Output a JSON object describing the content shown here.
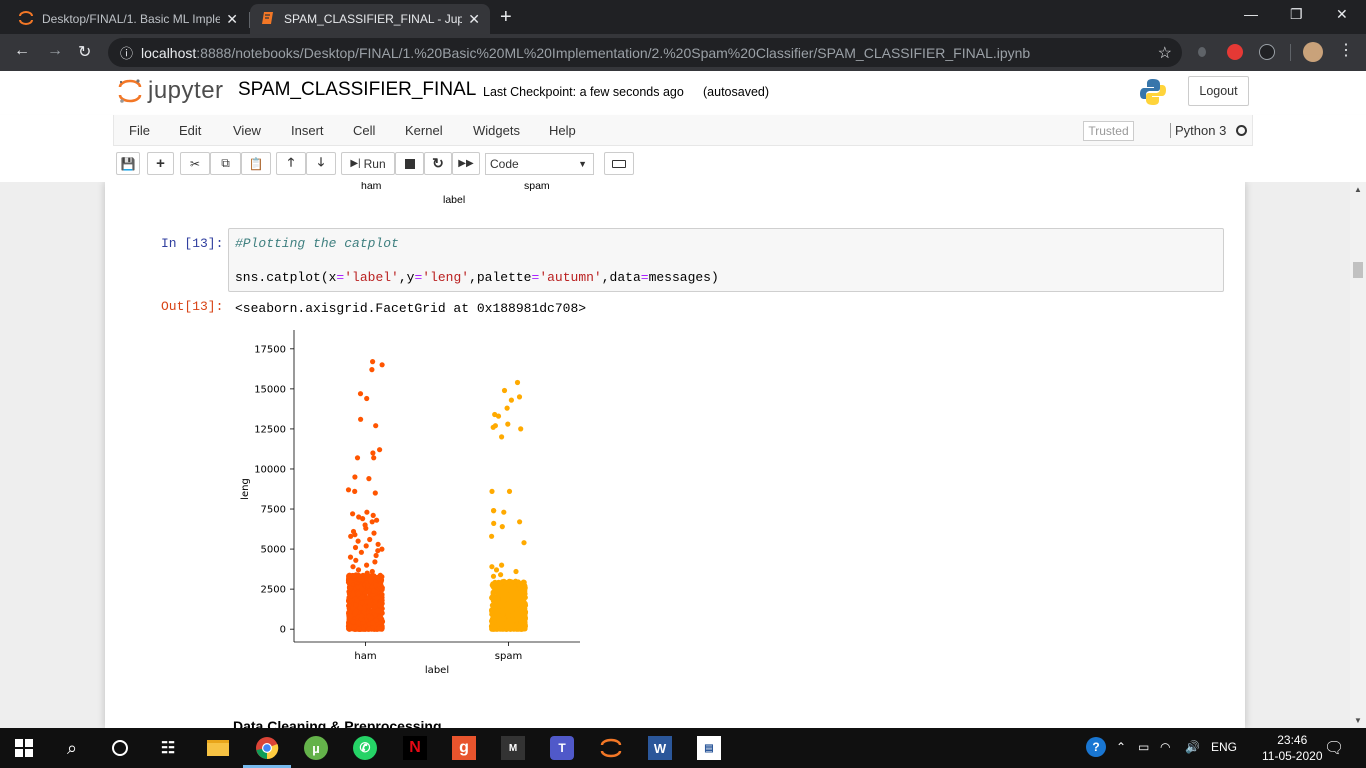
{
  "browser": {
    "tabs": [
      {
        "title": "Desktop/FINAL/1. Basic ML Imple",
        "active": false
      },
      {
        "title": "SPAM_CLASSIFIER_FINAL - Jupyte",
        "active": true
      }
    ],
    "url_host": "localhost",
    "url_path": ":8888/notebooks/Desktop/FINAL/1.%20Basic%20ML%20Implementation/2.%20Spam%20Classifier/SPAM_CLASSIFIER_FINAL.ipynb"
  },
  "jupyter": {
    "logo_text": "jupyter",
    "notebook_name": "SPAM_CLASSIFIER_FINAL",
    "checkpoint": "Last Checkpoint: a few seconds ago",
    "autosave": "(autosaved)",
    "logout_label": "Logout",
    "menu": [
      "File",
      "Edit",
      "View",
      "Insert",
      "Cell",
      "Kernel",
      "Widgets",
      "Help"
    ],
    "trusted_label": "Trusted",
    "kernel_name": "Python 3",
    "run_label": "Run",
    "cell_type": "Code"
  },
  "notebook": {
    "prev_plot": {
      "ticks": [
        "ham",
        "spam"
      ],
      "xlabel": "label"
    },
    "cell": {
      "in_prompt": "In [13]:",
      "comment": "#Plotting the catplot",
      "code": {
        "fn": "sns.catplot(x",
        "eq1": "=",
        "s1": "'label'",
        "c1": ",y",
        "eq2": "=",
        "s2": "'leng'",
        "c2": ",palette",
        "eq3": "=",
        "s3": "'autumn'",
        "c3": ",data",
        "eq4": "=",
        "end": "messages)"
      },
      "out_prompt": "Out[13]:",
      "out_text": "<seaborn.axisgrid.FacetGrid at 0x188981dc708>"
    },
    "next_heading": "Data Cleaning & Preprocessing"
  },
  "chart_data": {
    "type": "scatter",
    "kind": "strip (categorical scatter)",
    "xlabel": "label",
    "ylabel": "leng",
    "categories": [
      "ham",
      "spam"
    ],
    "ylim": [
      -800,
      18300
    ],
    "yticks": [
      0,
      2500,
      5000,
      7500,
      10000,
      12500,
      15000,
      17500
    ],
    "series": [
      {
        "name": "ham",
        "color": "#ff5500",
        "outliers": [
          16500,
          16700,
          16200,
          14700,
          14400,
          13100,
          12700,
          11200,
          11000,
          10700,
          10700,
          9500,
          9400,
          8700,
          8600,
          8500,
          7300,
          7200,
          7100,
          7000,
          6900,
          6800,
          6700,
          6500,
          6300,
          6100,
          6000,
          5900,
          5800,
          5600,
          5500,
          5300,
          5200,
          5100,
          5000,
          4900,
          4800,
          4600,
          4500,
          4300,
          4200,
          4000,
          3900,
          3700,
          3600,
          3500
        ],
        "dense_range": [
          0,
          3400
        ]
      },
      {
        "name": "spam",
        "color": "#ffaa00",
        "outliers": [
          15400,
          14900,
          14500,
          14300,
          13800,
          13400,
          13300,
          12800,
          12700,
          12600,
          12500,
          12000,
          8600,
          8600,
          7400,
          7400,
          7300,
          6700,
          6600,
          6400,
          5800,
          5400,
          4000,
          3900,
          3700,
          3600,
          3400,
          3300
        ],
        "dense_range": [
          0,
          3000
        ]
      }
    ],
    "spines": {
      "top": false,
      "right": false
    }
  },
  "taskbar": {
    "language": "ENG",
    "time": "23:46",
    "date": "11-05-2020"
  },
  "colors": {
    "jupyter_orange": "#f37726",
    "prompt_in": "#303f9f",
    "prompt_out": "#d84315",
    "ham": "#ff5500",
    "spam": "#ffaa00"
  }
}
